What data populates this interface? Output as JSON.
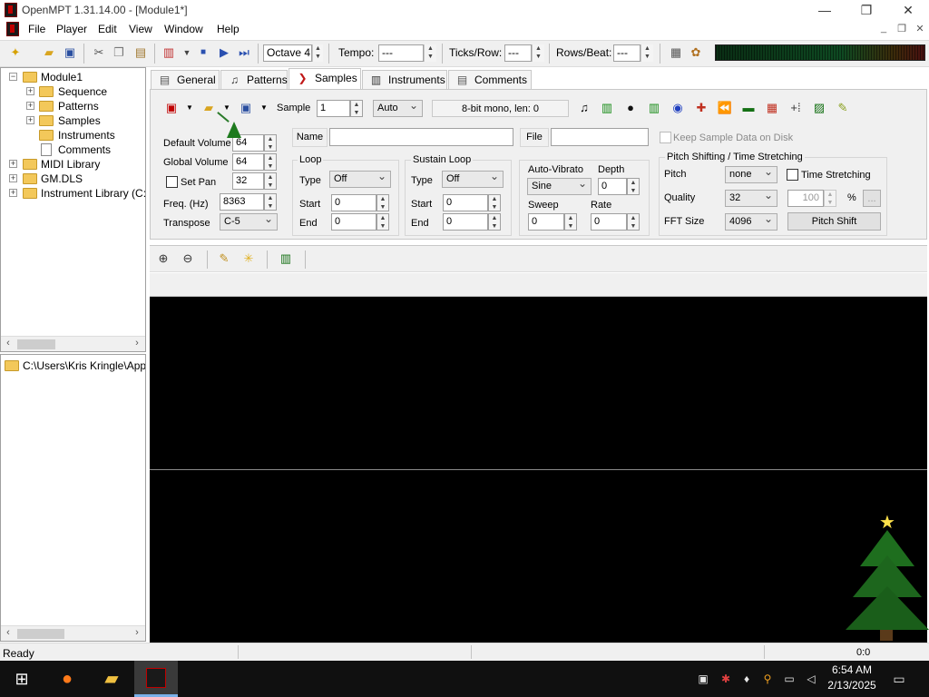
{
  "window": {
    "title": "OpenMPT 1.31.14.00 - [Module1*]",
    "minimize_glyph": "—",
    "maximize_glyph": "❐",
    "close_glyph": "✕"
  },
  "menu": {
    "items": [
      "File",
      "Player",
      "Edit",
      "View",
      "Window",
      "Help"
    ],
    "mdi_minimize": "_",
    "mdi_restore": "❐",
    "mdi_close": "✕"
  },
  "toolbar": {
    "octave_value": "Octave 4",
    "tempo_label": "Tempo:",
    "tempo_value": "---",
    "ticks_label": "Ticks/Row:",
    "ticks_value": "---",
    "rows_label": "Rows/Beat:",
    "rows_value": "---"
  },
  "tree": {
    "module_name": "Module1",
    "children": [
      "Sequence",
      "Patterns",
      "Samples",
      "Instruments",
      "Comments"
    ],
    "libraries": [
      "MIDI Library",
      "GM.DLS",
      "Instrument Library (C:\\Us"
    ]
  },
  "browser": {
    "path": "C:\\Users\\Kris Kringle\\AppD"
  },
  "tabs": [
    "General",
    "Patterns",
    "Samples",
    "Instruments",
    "Comments"
  ],
  "tabs_active_index": 2,
  "sample": {
    "sample_label": "Sample",
    "sample_number": "1",
    "auto_option": "Auto",
    "info_text": "8-bit mono, len: 0",
    "default_volume_label": "Default Volume",
    "default_volume_value": "64",
    "global_volume_label": "Global Volume",
    "global_volume_value": "64",
    "set_pan_label": "Set Pan",
    "set_pan_value": "32",
    "freq_label": "Freq. (Hz)",
    "freq_value": "8363",
    "transpose_label": "Transpose",
    "transpose_value": "C-5",
    "name_label": "Name",
    "name_value": "",
    "file_label": "File",
    "file_value": "",
    "keep_on_disk_label": "Keep Sample Data on Disk",
    "loop_title": "Loop",
    "loop_type_label": "Type",
    "loop_type_value": "Off",
    "loop_start_label": "Start",
    "loop_start_value": "0",
    "loop_end_label": "End",
    "loop_end_value": "0",
    "sustain_title": "Sustain Loop",
    "sustain_type_label": "Type",
    "sustain_type_value": "Off",
    "sustain_start_label": "Start",
    "sustain_start_value": "0",
    "sustain_end_label": "End",
    "sustain_end_value": "0",
    "vibrato_title": "Auto-Vibrato",
    "vibrato_type_value": "Sine",
    "depth_label": "Depth",
    "depth_value": "0",
    "sweep_label": "Sweep",
    "sweep_value": "0",
    "rate_label": "Rate",
    "rate_value": "0",
    "pitch_title": "Pitch Shifting / Time Stretching",
    "pitch_label": "Pitch",
    "pitch_value": "none",
    "time_stretching_label": "Time Stretching",
    "quality_label": "Quality",
    "quality_value": "32",
    "stretch_value": "100",
    "percent_label": "%",
    "ellipsis_label": "...",
    "fft_label": "FFT Size",
    "fft_value": "4096",
    "pitch_shift_button": "Pitch Shift"
  },
  "statusbar": {
    "text": "Ready",
    "time_text": "0:0"
  },
  "taskbar": {
    "time": "6:54 AM",
    "date": "2/13/2025"
  }
}
